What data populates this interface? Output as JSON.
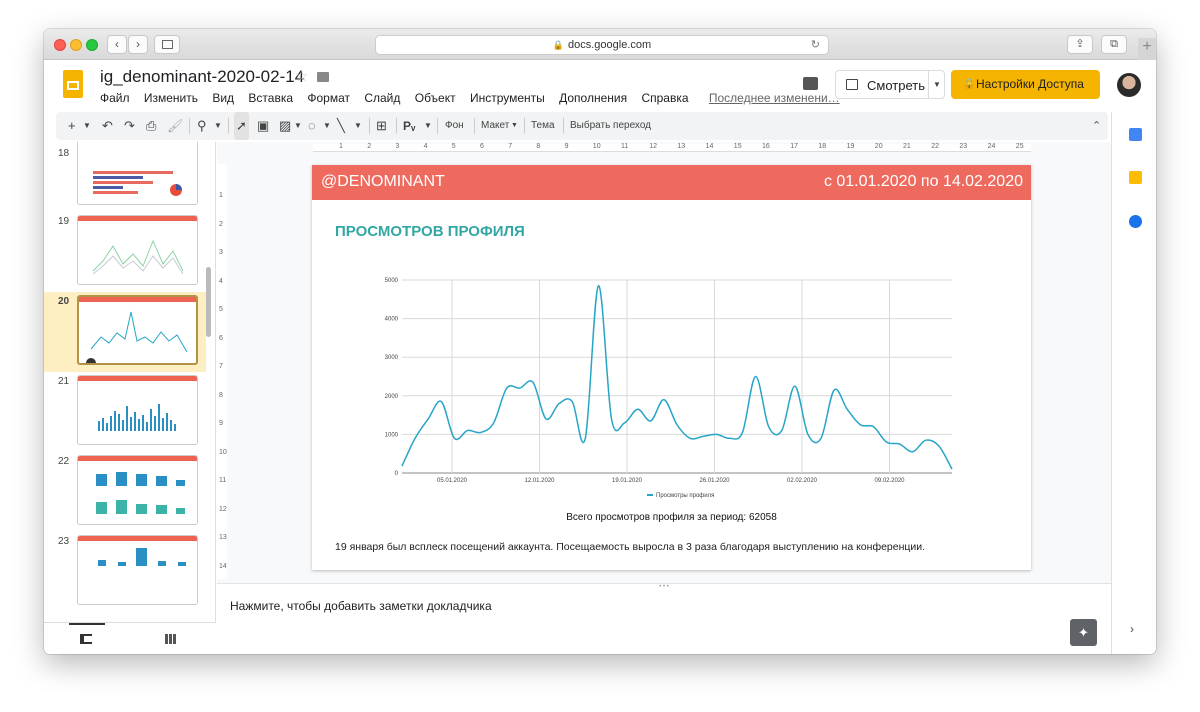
{
  "browser": {
    "url": "docs.google.com",
    "nav_back": "‹",
    "nav_forward": "›"
  },
  "header": {
    "doc_title": "ig_denominant-2020-02-14",
    "menu": [
      "Файл",
      "Изменить",
      "Вид",
      "Вставка",
      "Формат",
      "Слайд",
      "Объект",
      "Инструменты",
      "Дополнения",
      "Справка"
    ],
    "last_edit": "Последнее изменени…",
    "present_label": "Смотреть",
    "share_label": "Настройки Доступа"
  },
  "toolbar": {
    "plus": "+",
    "bg_label": "Фон",
    "layout_label": "Макет",
    "theme_label": "Тема",
    "transition_label": "Выбрать переход"
  },
  "filmstrip": {
    "slides": [
      {
        "num": "18"
      },
      {
        "num": "19"
      },
      {
        "num": "20"
      },
      {
        "num": "21"
      },
      {
        "num": "22"
      },
      {
        "num": "23"
      }
    ],
    "selected": "20"
  },
  "ruler": {
    "h_ticks": [
      "1",
      "2",
      "3",
      "4",
      "5",
      "6",
      "7",
      "8",
      "9",
      "10",
      "11",
      "12",
      "13",
      "14",
      "15",
      "16",
      "17",
      "18",
      "19",
      "20",
      "21",
      "22",
      "23",
      "24",
      "25"
    ],
    "v_ticks": [
      "1",
      "2",
      "3",
      "4",
      "5",
      "6",
      "7",
      "8",
      "9",
      "10",
      "11",
      "12",
      "13",
      "14"
    ]
  },
  "slide": {
    "handle": "@DENOMINANT",
    "period": "с 01.01.2020 по 14.02.2020",
    "title": "ПРОСМОТРОВ ПРОФИЛЯ",
    "total": "Всего просмотров профиля за период: 62058",
    "note": "19 января был всплеск посещений аккаунта. Посещаемость выросла в 3 раза благодаря выступлению на конференции."
  },
  "chart_data": {
    "type": "line",
    "x": [
      "01.01",
      "02.01",
      "03.01",
      "04.01",
      "05.01",
      "06.01",
      "07.01",
      "08.01",
      "09.01",
      "10.01",
      "11.01",
      "12.01",
      "13.01",
      "14.01",
      "15.01",
      "16.01",
      "17.01",
      "18.01",
      "19.01",
      "20.01",
      "21.01",
      "22.01",
      "23.01",
      "24.01",
      "25.01",
      "26.01",
      "27.01",
      "28.01",
      "29.01",
      "30.01",
      "31.01",
      "01.02",
      "02.02",
      "03.02",
      "04.02",
      "05.02",
      "06.02",
      "07.02",
      "08.02",
      "09.02",
      "10.02",
      "11.02",
      "12.02",
      "13.02",
      "14.02"
    ],
    "series": [
      {
        "name": "Просмотры профиля",
        "color": "#26a5c7",
        "values": [
          180,
          900,
          1400,
          1850,
          900,
          1100,
          1050,
          1300,
          2200,
          2200,
          2350,
          1400,
          1800,
          1850,
          900,
          4850,
          1400,
          1300,
          1650,
          1350,
          1900,
          1250,
          900,
          950,
          1000,
          900,
          1050,
          2500,
          1200,
          1100,
          2250,
          1000,
          900,
          2150,
          1650,
          1250,
          1200,
          800,
          750,
          550,
          850,
          700,
          100
        ]
      }
    ],
    "xticks": [
      "05.01.2020",
      "12.01.2020",
      "19.01.2020",
      "26.01.2020",
      "02.02.2020",
      "09.02.2020"
    ],
    "yticks": [
      "0",
      "1000",
      "2000",
      "3000",
      "4000",
      "5000"
    ],
    "ylim": [
      0,
      5000
    ],
    "grid": true,
    "legend": "bottom"
  },
  "notes": {
    "placeholder": "Нажмите, чтобы добавить заметки докладчика"
  }
}
